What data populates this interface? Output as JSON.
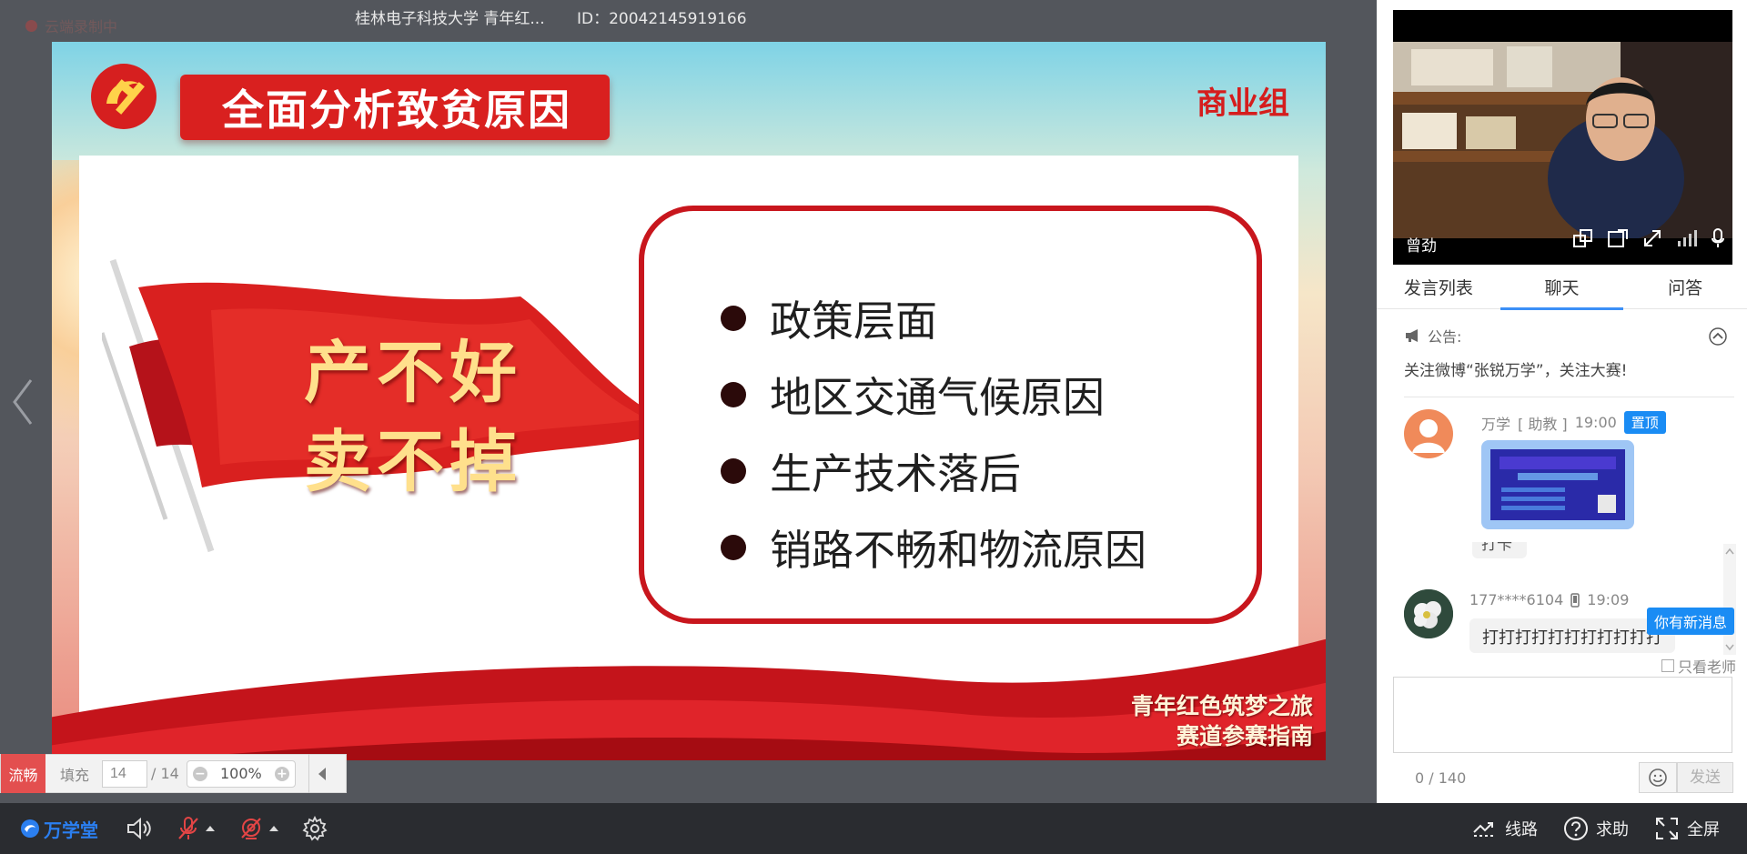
{
  "top": {
    "recording_label": "云端录制中",
    "room_title": "桂林电子科技大学 青年红...",
    "room_id": "ID：20042145919166"
  },
  "slide": {
    "title": "全面分析致贫原因",
    "group": "商业组",
    "flag_line1": "产不好",
    "flag_line2": "卖不掉",
    "points": [
      "政策层面",
      "地区交通气候原因",
      "生产技术落后",
      "销路不畅和物流原因"
    ],
    "footer_line1": "青年红色筑梦之旅",
    "footer_line2": "赛道参赛指南"
  },
  "slide_toolbar": {
    "smooth_label": "流畅",
    "fill_label": "填充",
    "current_page": "14",
    "total_pages": "/ 14",
    "zoom": "100%"
  },
  "video": {
    "teacher_name": "曾劲"
  },
  "tabs": [
    "发言列表",
    "聊天",
    "问答"
  ],
  "notice": {
    "label": "公告:",
    "text": "关注微博“张锐万学”，关注大赛!"
  },
  "messages": [
    {
      "user": "万学",
      "role": "[ 助教 ]",
      "time": "19:00",
      "badge": "置顶"
    },
    {
      "partial_text": "打卡"
    },
    {
      "user": "177****6104",
      "time": "19:09",
      "text": "打打打打打打打打打打打"
    }
  ],
  "chat": {
    "new_message_badge": "你有新消息",
    "teacher_only_label": "只看老师",
    "counter": "0 / 140",
    "send_label": "发送"
  },
  "bottom_bar": {
    "brand": "万学堂",
    "route_label": "线路",
    "help_label": "求助",
    "fullscreen_label": "全屏"
  },
  "colors": {
    "accent_blue": "#1a8cf4",
    "slide_red": "#d9201f",
    "bar_dark": "#2a2c30"
  }
}
